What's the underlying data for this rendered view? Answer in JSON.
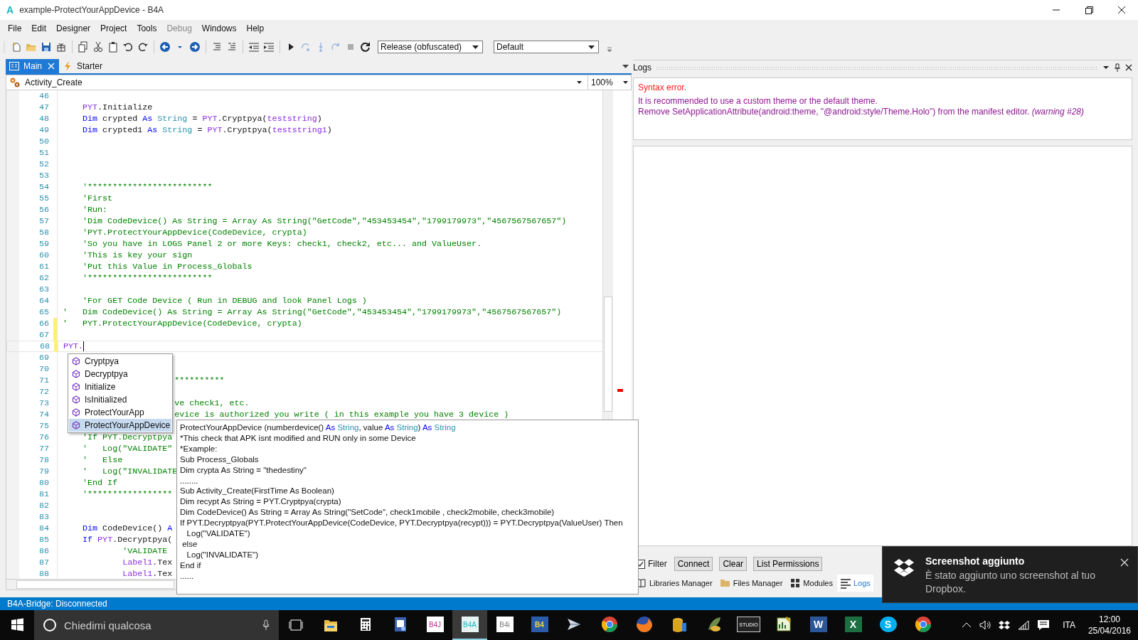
{
  "window": {
    "icon_letter": "A",
    "title": "example-ProtectYourAppDevice - B4A"
  },
  "menu": [
    {
      "label": "File",
      "disabled": false
    },
    {
      "label": "Edit",
      "disabled": false
    },
    {
      "label": "Designer",
      "disabled": false
    },
    {
      "label": "Project",
      "disabled": false
    },
    {
      "label": "Tools",
      "disabled": false
    },
    {
      "label": "Debug",
      "disabled": true
    },
    {
      "label": "Windows",
      "disabled": false
    },
    {
      "label": "Help",
      "disabled": false
    }
  ],
  "toolbar": {
    "items": [
      {
        "kind": "new",
        "disabled": false
      },
      {
        "kind": "open",
        "disabled": false
      },
      {
        "kind": "save",
        "disabled": false
      },
      {
        "kind": "package",
        "disabled": false
      },
      {
        "kind": "sep"
      },
      {
        "kind": "copy",
        "disabled": false
      },
      {
        "kind": "cut",
        "disabled": false
      },
      {
        "kind": "paste",
        "disabled": false
      },
      {
        "kind": "undo",
        "disabled": false
      },
      {
        "kind": "redo",
        "disabled": false
      },
      {
        "kind": "sep"
      },
      {
        "kind": "back",
        "disabled": false
      },
      {
        "kind": "caret",
        "disabled": false
      },
      {
        "kind": "forward",
        "disabled": false
      },
      {
        "kind": "sep"
      },
      {
        "kind": "comment",
        "disabled": false
      },
      {
        "kind": "uncomment",
        "disabled": false
      },
      {
        "kind": "sep"
      },
      {
        "kind": "outdent",
        "disabled": false
      },
      {
        "kind": "indent",
        "disabled": false
      },
      {
        "kind": "sep"
      },
      {
        "kind": "play",
        "disabled": false
      },
      {
        "kind": "step",
        "disabled": true
      },
      {
        "kind": "stepin",
        "disabled": true
      },
      {
        "kind": "stepout",
        "disabled": true
      },
      {
        "kind": "stop",
        "disabled": true
      },
      {
        "kind": "restart",
        "disabled": false
      }
    ],
    "build_config": "Release (obfuscated)",
    "device": "Default"
  },
  "editor": {
    "tabs": [
      {
        "label": "Main",
        "kind": "layout",
        "selected": true
      },
      {
        "label": "Starter",
        "kind": "lightning",
        "selected": false
      }
    ],
    "sub": "Activity_Create",
    "zoom": "100%",
    "lines": [
      {
        "number": "46",
        "changed": false,
        "current": false
      },
      {
        "number": "47",
        "changed": false,
        "current": false,
        "tokens": [
          {
            "kind": "obj",
            "text": "    PYT"
          },
          {
            "kind": "plain",
            "text": ".Initialize"
          }
        ]
      },
      {
        "number": "48",
        "changed": false,
        "current": false,
        "tokens": [
          {
            "kind": "kw",
            "text": "    Dim"
          },
          {
            "kind": "plain",
            "text": " crypted "
          },
          {
            "kind": "kw",
            "text": "As "
          },
          {
            "kind": "type",
            "text": "String"
          },
          {
            "kind": "plain",
            "text": " = "
          },
          {
            "kind": "obj",
            "text": "PYT"
          },
          {
            "kind": "plain",
            "text": ".Cryptpya("
          },
          {
            "kind": "obj",
            "text": "teststring"
          },
          {
            "kind": "plain",
            "text": ")"
          }
        ]
      },
      {
        "number": "49",
        "changed": false,
        "current": false,
        "tokens": [
          {
            "kind": "kw",
            "text": "    Dim"
          },
          {
            "kind": "plain",
            "text": " crypted1 "
          },
          {
            "kind": "kw",
            "text": "As "
          },
          {
            "kind": "type",
            "text": "String"
          },
          {
            "kind": "plain",
            "text": " = "
          },
          {
            "kind": "obj",
            "text": "PYT"
          },
          {
            "kind": "plain",
            "text": ".Cryptpya("
          },
          {
            "kind": "obj",
            "text": "teststring1"
          },
          {
            "kind": "plain",
            "text": ")"
          }
        ]
      },
      {
        "number": "50",
        "changed": false,
        "current": false
      },
      {
        "number": "51",
        "changed": false,
        "current": false
      },
      {
        "number": "52",
        "changed": false,
        "current": false
      },
      {
        "number": "53",
        "changed": false,
        "current": false
      },
      {
        "number": "54",
        "changed": false,
        "current": false,
        "tokens": [
          {
            "kind": "comment",
            "text": "    '*************************"
          }
        ]
      },
      {
        "number": "55",
        "changed": false,
        "current": false,
        "tokens": [
          {
            "kind": "comment",
            "text": "    'First"
          }
        ]
      },
      {
        "number": "56",
        "changed": false,
        "current": false,
        "tokens": [
          {
            "kind": "comment",
            "text": "    'Run:"
          }
        ]
      },
      {
        "number": "57",
        "changed": false,
        "current": false,
        "tokens": [
          {
            "kind": "comment",
            "text": "    'Dim CodeDevice() As String = Array As String(\"GetCode\",\"453453454\",\"1799179973\",\"4567567567657\")"
          }
        ]
      },
      {
        "number": "58",
        "changed": false,
        "current": false,
        "tokens": [
          {
            "kind": "comment",
            "text": "    'PYT.ProtectYourAppDevice(CodeDevice, crypta)"
          }
        ]
      },
      {
        "number": "59",
        "changed": false,
        "current": false,
        "tokens": [
          {
            "kind": "comment",
            "text": "    'So you have in LOGS Panel 2 or more Keys: check1, check2, etc... and ValueUser."
          }
        ]
      },
      {
        "number": "60",
        "changed": false,
        "current": false,
        "tokens": [
          {
            "kind": "comment",
            "text": "    'This is key your sign"
          }
        ]
      },
      {
        "number": "61",
        "changed": false,
        "current": false,
        "tokens": [
          {
            "kind": "comment",
            "text": "    'Put this Value in Process_Globals"
          }
        ]
      },
      {
        "number": "62",
        "changed": false,
        "current": false,
        "tokens": [
          {
            "kind": "comment",
            "text": "    '*************************"
          }
        ]
      },
      {
        "number": "63",
        "changed": false,
        "current": false
      },
      {
        "number": "64",
        "changed": false,
        "current": false,
        "tokens": [
          {
            "kind": "comment",
            "text": "    'For GET Code Device ( Run in DEBUG and look Panel Logs )"
          }
        ]
      },
      {
        "number": "65",
        "changed": false,
        "current": false,
        "tokens": [
          {
            "kind": "comment",
            "text": "'   Dim CodeDevice() As String = Array As String(\"GetCode\",\"453453454\",\"1799179973\",\"4567567567657\")"
          }
        ]
      },
      {
        "number": "66",
        "changed": true,
        "current": false,
        "tokens": [
          {
            "kind": "comment",
            "text": "'   PYT.ProtectYourAppDevice(CodeDevice, crypta)"
          }
        ]
      },
      {
        "number": "67",
        "changed": true,
        "current": false
      },
      {
        "number": "68",
        "changed": true,
        "current": true,
        "tokens": [
          {
            "kind": "obj",
            "text": "PYT."
          }
        ]
      },
      {
        "number": "69",
        "changed": false,
        "current": false
      },
      {
        "number": "70",
        "changed": false,
        "current": false
      },
      {
        "number": "71",
        "changed": false,
        "current": false,
        "after_popup": true,
        "tokens": [
          {
            "kind": "comment",
            "text": "**********"
          }
        ]
      },
      {
        "number": "72",
        "changed": false,
        "current": false
      },
      {
        "number": "73",
        "changed": false,
        "current": false,
        "after_popup": true,
        "tokens": [
          {
            "kind": "comment",
            "text": "ve check1, etc."
          }
        ]
      },
      {
        "number": "74",
        "changed": false,
        "current": false,
        "after_popup": true,
        "tokens": [
          {
            "kind": "comment",
            "text": "evice is authorized you write ( in this example you have 3 device )"
          }
        ]
      },
      {
        "number": "75",
        "changed": false,
        "current": false
      },
      {
        "number": "76",
        "changed": false,
        "current": false,
        "tokens": [
          {
            "kind": "comment",
            "text": "    'If PYT.Decryptpya"
          }
        ]
      },
      {
        "number": "77",
        "changed": false,
        "current": false,
        "tokens": [
          {
            "kind": "comment",
            "text": "    '   Log(\"VALIDATE\""
          }
        ]
      },
      {
        "number": "78",
        "changed": false,
        "current": false,
        "tokens": [
          {
            "kind": "comment",
            "text": "    '   Else"
          }
        ]
      },
      {
        "number": "79",
        "changed": false,
        "current": false,
        "tokens": [
          {
            "kind": "comment",
            "text": "    '   Log(\"INVALIDATE"
          }
        ]
      },
      {
        "number": "80",
        "changed": false,
        "current": false,
        "tokens": [
          {
            "kind": "comment",
            "text": "    'End If"
          }
        ]
      },
      {
        "number": "81",
        "changed": false,
        "current": false,
        "tokens": [
          {
            "kind": "comment",
            "text": "    '*****************"
          }
        ]
      },
      {
        "number": "82",
        "changed": false,
        "current": false
      },
      {
        "number": "83",
        "changed": false,
        "current": false
      },
      {
        "number": "84",
        "changed": false,
        "current": false,
        "tokens": [
          {
            "kind": "kw",
            "text": "    Dim"
          },
          {
            "kind": "plain",
            "text": " CodeDevice() "
          },
          {
            "kind": "kw",
            "text": "A"
          }
        ]
      },
      {
        "number": "85",
        "changed": false,
        "current": false,
        "tokens": [
          {
            "kind": "kw",
            "text": "    If "
          },
          {
            "kind": "obj",
            "text": "PYT"
          },
          {
            "kind": "plain",
            "text": ".Decryptpya("
          }
        ]
      },
      {
        "number": "86",
        "changed": false,
        "current": false,
        "tokens": [
          {
            "kind": "comment",
            "text": "            'VALIDATE"
          }
        ]
      },
      {
        "number": "87",
        "changed": false,
        "current": false,
        "tokens": [
          {
            "kind": "obj",
            "text": "            Label1"
          },
          {
            "kind": "plain",
            "text": ".Tex"
          }
        ]
      },
      {
        "number": "88",
        "changed": false,
        "current": false,
        "tokens": [
          {
            "kind": "obj",
            "text": "            Label1"
          },
          {
            "kind": "plain",
            "text": ".Tex"
          }
        ]
      }
    ],
    "autocomplete": [
      {
        "label": "Cryptpya",
        "selected": false
      },
      {
        "label": "Decryptpya",
        "selected": false
      },
      {
        "label": "Initialize",
        "selected": false
      },
      {
        "label": "IsInitialized",
        "selected": false
      },
      {
        "label": "ProtectYourApp",
        "selected": false
      },
      {
        "label": "ProtectYourAppDevice",
        "selected": true
      }
    ],
    "tooltip": {
      "signature": [
        {
          "kind": "plain",
          "text": "ProtectYourAppDevice (numberdevice() "
        },
        {
          "kind": "kw",
          "text": "As "
        },
        {
          "kind": "type",
          "text": "String"
        },
        {
          "kind": "plain",
          "text": ", value "
        },
        {
          "kind": "kw",
          "text": "As "
        },
        {
          "kind": "type",
          "text": "String"
        },
        {
          "kind": "plain",
          "text": ") "
        },
        {
          "kind": "kw",
          "text": "As "
        },
        {
          "kind": "type",
          "text": "String"
        }
      ],
      "lines": [
        "*This check that APK isnt modified and RUN only in some Device",
        "*Example:",
        "Sub Process_Globals",
        "Dim crypta As String = \"thedestiny\"",
        "........",
        "Sub Activity_Create(FirstTime As Boolean)",
        "Dim recypt As String = PYT.Cryptpya(crypta)",
        "Dim CodeDevice() As String = Array As String(\"SetCode\", check1mobile , check2mobile, check3mobile)",
        "If PYT.Decryptpya(PYT.ProtectYourAppDevice(CodeDevice, PYT.Decryptpya(recypt))) = PYT.Decryptpya(ValueUser) Then",
        "   Log(\"VALIDATE\")",
        " else",
        "   Log(\"INVALIDATE\")",
        "End if",
        "......"
      ]
    }
  },
  "logs": {
    "title": "Logs",
    "messages": [
      {
        "kind": "error",
        "lines": [
          "Syntax error."
        ]
      },
      {
        "kind": "warning",
        "lines": [
          "It is recommended to use a custom theme or the default theme.",
          "Remove SetApplicationAttribute(android:theme, \"@android:style/Theme.Holo\") from the manifest editor. *(warning #28)*"
        ]
      }
    ],
    "filter": {
      "label": "Filter",
      "checked": true
    },
    "buttons": [
      "Connect",
      "Clear",
      "List Permissions"
    ],
    "tabs": [
      {
        "label": "Libraries Manager",
        "kind": "book",
        "selected": false
      },
      {
        "label": "Files Manager",
        "kind": "folder",
        "selected": false
      },
      {
        "label": "Modules",
        "kind": "modules",
        "selected": false
      },
      {
        "label": "Logs",
        "kind": "lines",
        "selected": true
      }
    ]
  },
  "status_bar": "B4A-Bridge: Disconnected",
  "taskbar": {
    "search": {
      "placeholder": "Chiedimi qualcosa"
    },
    "apps": [
      {
        "kind": "folder",
        "selected": false
      },
      {
        "kind": "calculator",
        "selected": false
      },
      {
        "kind": "document",
        "selected": false
      },
      {
        "kind": "tile",
        "label": "B4J",
        "selected": false
      },
      {
        "kind": "tile",
        "label": "B4A",
        "selected": true
      },
      {
        "kind": "tile",
        "label": "B4i",
        "selected": false
      },
      {
        "kind": "tile",
        "label": "B4",
        "selected": false
      },
      {
        "kind": "plane",
        "selected": false
      },
      {
        "kind": "ring",
        "selected": false
      },
      {
        "kind": "globe",
        "selected": false
      },
      {
        "kind": "database",
        "selected": false
      },
      {
        "kind": "feather",
        "selected": false
      },
      {
        "kind": "tile",
        "label": "STUDIO",
        "selected": false
      },
      {
        "kind": "chart",
        "selected": false
      },
      {
        "kind": "tile",
        "label": "W",
        "selected": false
      },
      {
        "kind": "tile",
        "label": "X",
        "selected": false
      },
      {
        "kind": "tile",
        "label": "S",
        "selected": false
      },
      {
        "kind": "ring",
        "selected": false
      }
    ],
    "language": "ITA",
    "time": "12:00",
    "date": "25/04/2016"
  },
  "notification": {
    "title": "Screenshot aggiunto",
    "text": "È stato aggiunto uno screenshot al tuo Dropbox."
  }
}
